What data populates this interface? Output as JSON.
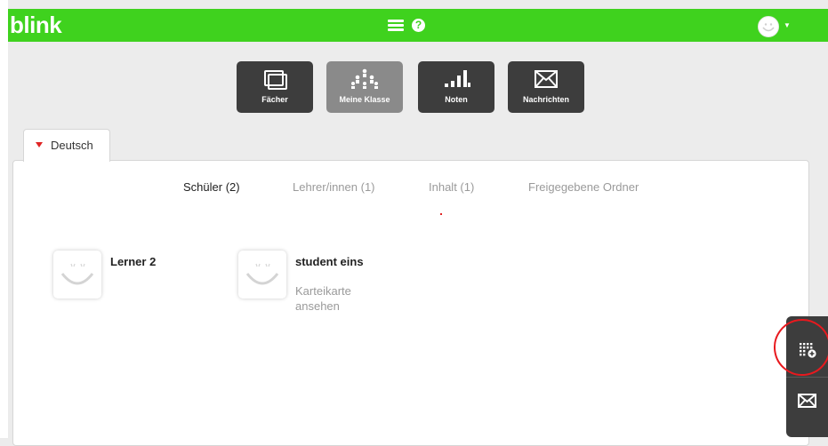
{
  "header": {
    "logo": "blink",
    "help_glyph": "?",
    "icons": [
      "menu-icon",
      "help-icon",
      "avatar-icon",
      "caret-down-icon"
    ],
    "accent_color": "#3fd21e"
  },
  "nav": [
    {
      "label": "Fächer",
      "icon": "folder-icon",
      "active": false
    },
    {
      "label": "Meine Klasse",
      "icon": "class-icon",
      "active": true
    },
    {
      "label": "Noten",
      "icon": "grades-icon",
      "active": false
    },
    {
      "label": "Nachrichten",
      "icon": "mail-icon",
      "active": false
    }
  ],
  "course_tab": {
    "label": "Deutsch",
    "caret_color": "#e02424"
  },
  "subtabs": [
    {
      "label": "Schüler (2)",
      "active": true
    },
    {
      "label": "Lehrer/innen (1)",
      "active": false
    },
    {
      "label": "Inhalt (1)",
      "active": false
    },
    {
      "label": "Freigegebene Ordner",
      "active": false
    }
  ],
  "students": [
    {
      "name": "Lerner 2",
      "link": ""
    },
    {
      "name": "student eins",
      "link": "Karteikarte ansehen"
    }
  ],
  "fab": [
    {
      "icon": "add-grid-icon",
      "highlighted": true
    },
    {
      "icon": "mail-icon",
      "highlighted": false
    }
  ],
  "highlight_color": "#e8191e"
}
